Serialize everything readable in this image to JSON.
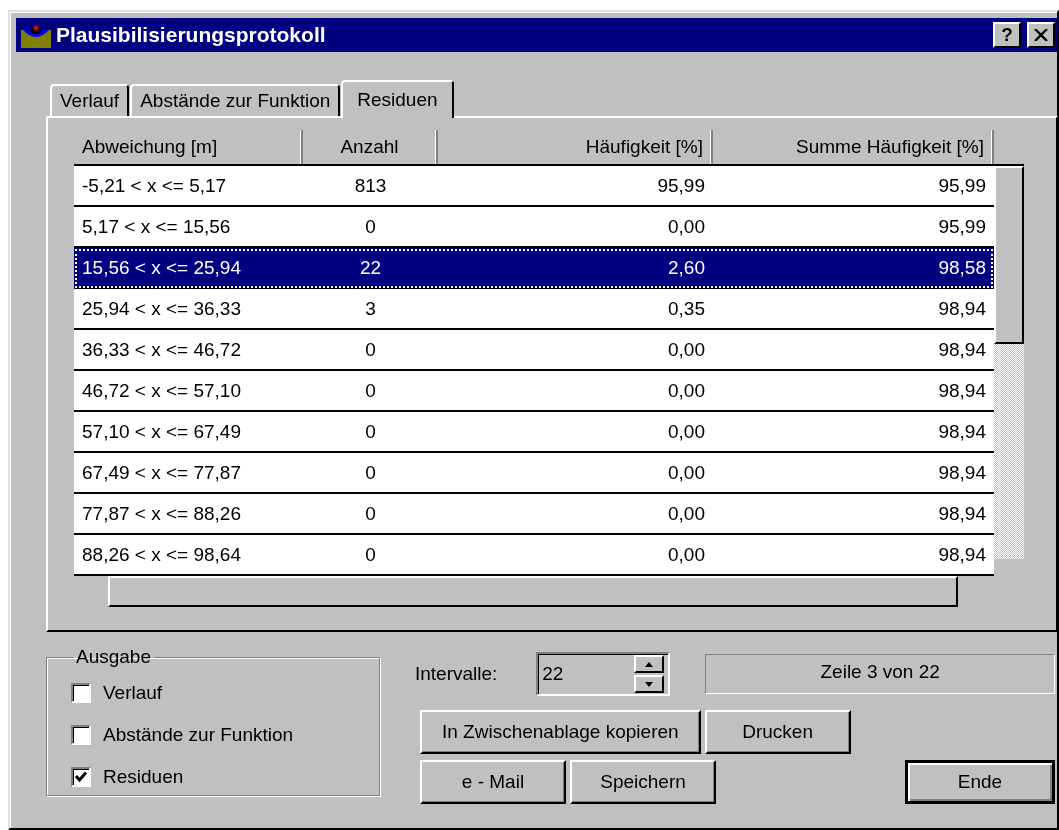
{
  "window": {
    "title": "Plausibilisierungsprotokoll",
    "help_button": "?"
  },
  "tabs": [
    {
      "label": "Verlauf",
      "selected": false
    },
    {
      "label": "Abstände zur Funktion",
      "selected": false
    },
    {
      "label": "Residuen",
      "selected": true
    }
  ],
  "table": {
    "columns": [
      "Abweichung [m]",
      "Anzahl",
      "Häufigkeit [%]",
      "Summe Häufigkeit [%]"
    ],
    "rows": [
      {
        "cells": [
          "-5,21 < x <= 5,17",
          "813",
          "95,99",
          "95,99"
        ],
        "selected": false
      },
      {
        "cells": [
          "5,17 < x <= 15,56",
          "0",
          "0,00",
          "95,99"
        ],
        "selected": false
      },
      {
        "cells": [
          "15,56 < x <= 25,94",
          "22",
          "2,60",
          "98,58"
        ],
        "selected": true
      },
      {
        "cells": [
          "25,94 < x <= 36,33",
          "3",
          "0,35",
          "98,94"
        ],
        "selected": false
      },
      {
        "cells": [
          "36,33 < x <= 46,72",
          "0",
          "0,00",
          "98,94"
        ],
        "selected": false
      },
      {
        "cells": [
          "46,72 < x <= 57,10",
          "0",
          "0,00",
          "98,94"
        ],
        "selected": false
      },
      {
        "cells": [
          "57,10 < x <= 67,49",
          "0",
          "0,00",
          "98,94"
        ],
        "selected": false
      },
      {
        "cells": [
          "67,49 < x <= 77,87",
          "0",
          "0,00",
          "98,94"
        ],
        "selected": false
      },
      {
        "cells": [
          "77,87 < x <= 88,26",
          "0",
          "0,00",
          "98,94"
        ],
        "selected": false
      },
      {
        "cells": [
          "88,26 < x <= 98,64",
          "0",
          "0,00",
          "98,94"
        ],
        "selected": false
      }
    ]
  },
  "output": {
    "title": "Ausgabe",
    "options": [
      {
        "label": "Verlauf",
        "checked": false
      },
      {
        "label": "Abstände zur Funktion",
        "checked": false
      },
      {
        "label": "Residuen",
        "checked": true
      }
    ]
  },
  "intervals": {
    "label": "Intervalle:",
    "value": "22"
  },
  "status": "Zeile 3 von 22",
  "button_rows": [
    [
      {
        "label": "In Zwischenablage kopieren",
        "default": false
      },
      {
        "label": "Drucken",
        "default": false
      }
    ],
    [
      {
        "label": "e - Mail",
        "default": false
      },
      {
        "label": "Speichern",
        "default": false
      },
      {
        "label": "Ende",
        "default": true
      }
    ]
  ]
}
